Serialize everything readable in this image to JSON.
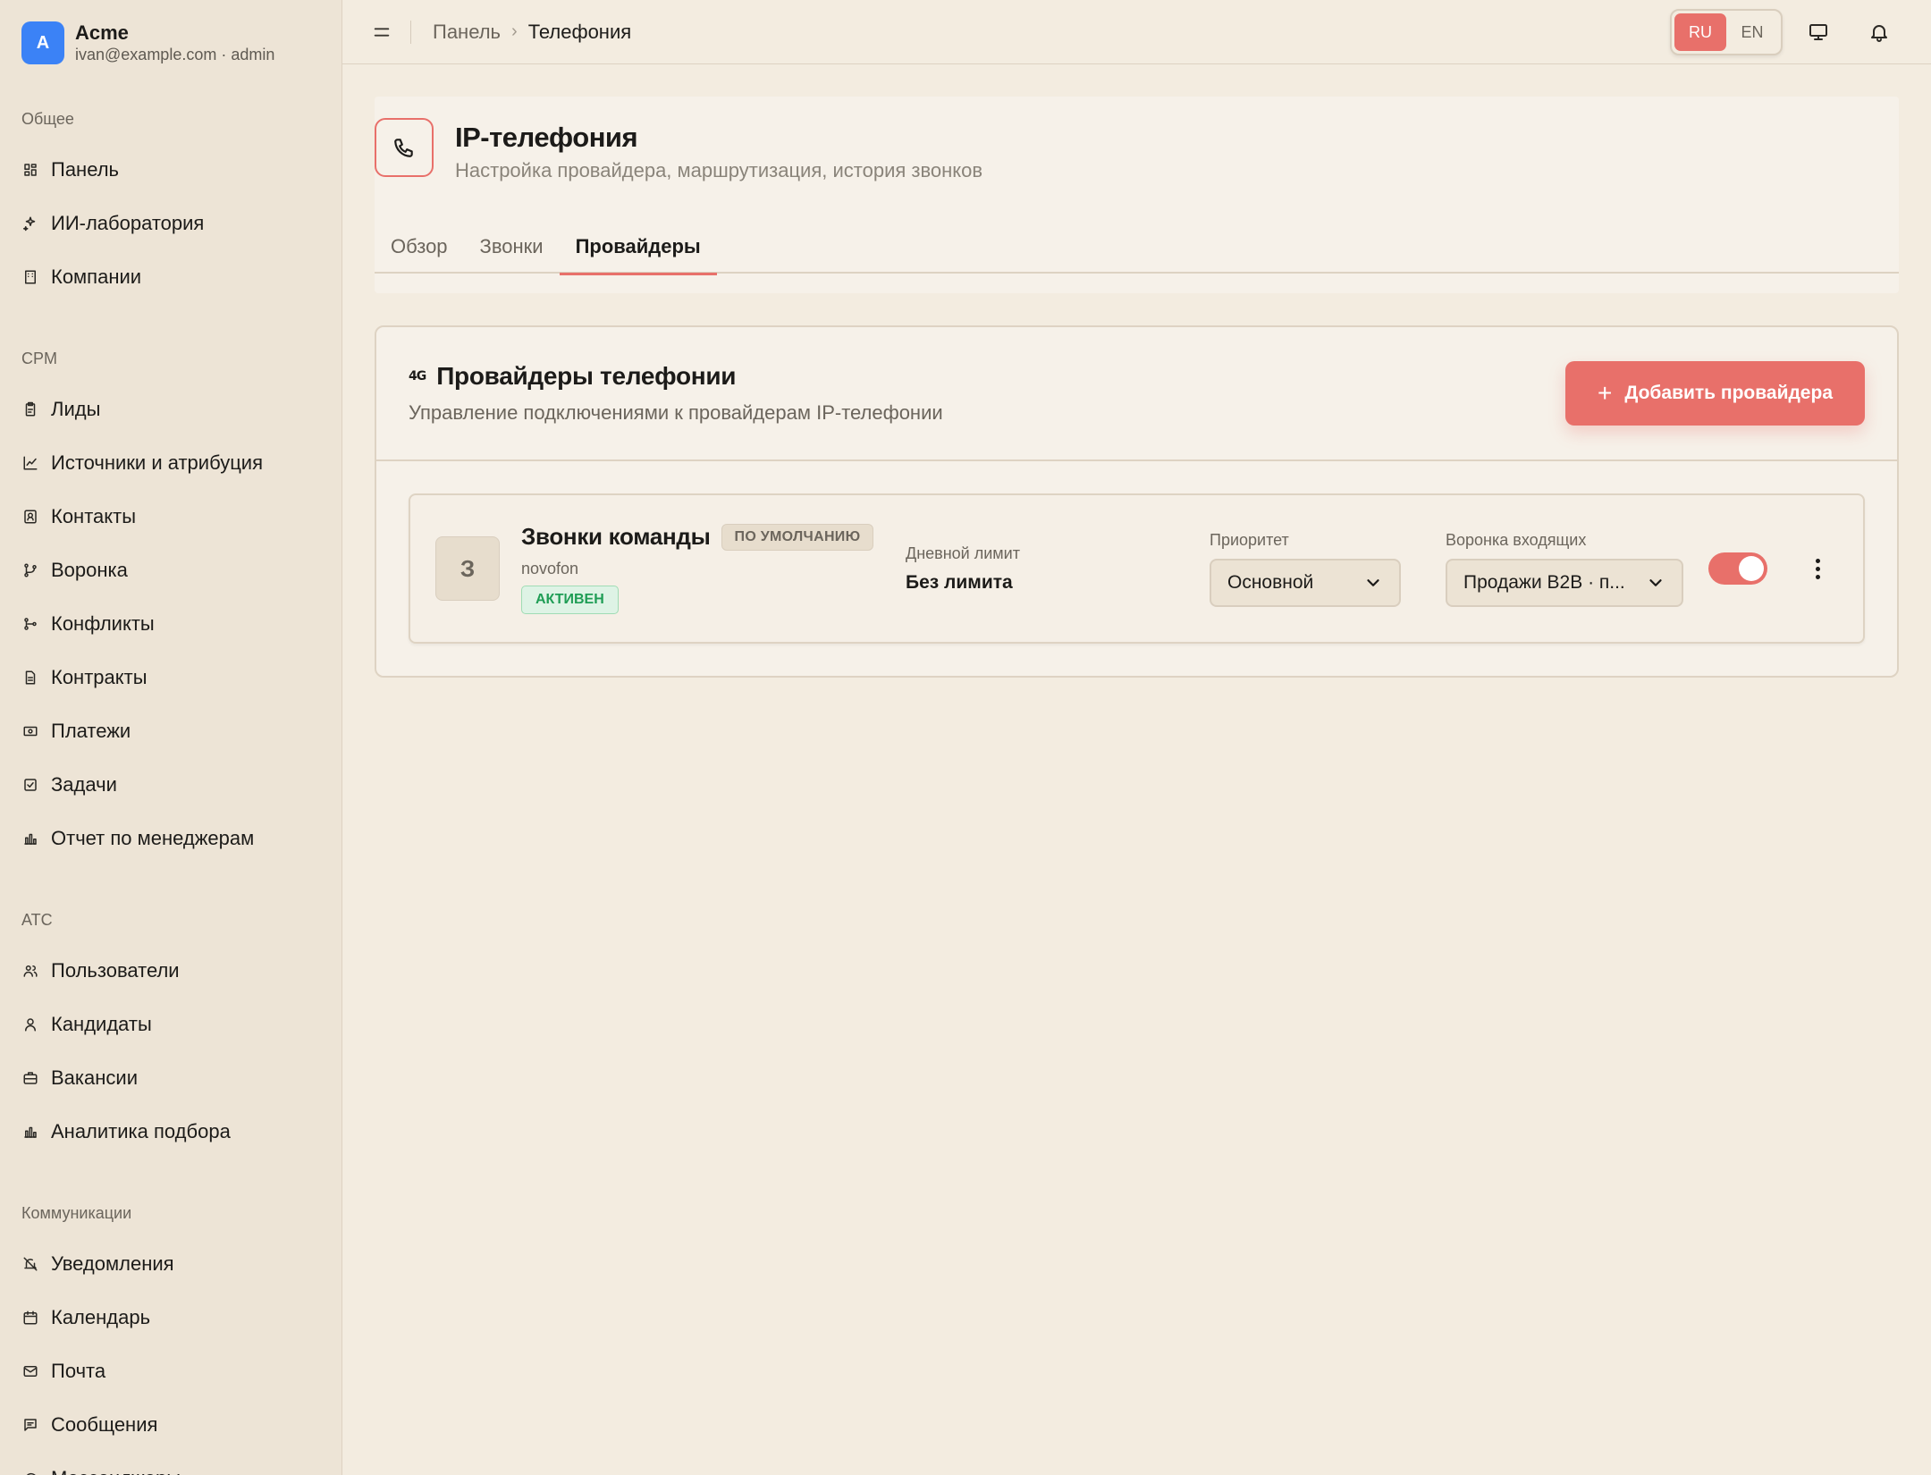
{
  "brand": {
    "initial": "A",
    "name": "Acme",
    "sub": "ivan@example.com · admin"
  },
  "sidebar": {
    "sections": [
      {
        "label": "Общее",
        "items": [
          {
            "label": "Панель",
            "icon": "dashboard-icon"
          },
          {
            "label": "ИИ-лаборатория",
            "icon": "sparkles-icon"
          },
          {
            "label": "Компании",
            "icon": "building-icon"
          }
        ]
      },
      {
        "label": "CPM",
        "items": [
          {
            "label": "Лиды",
            "icon": "clipboard-icon"
          },
          {
            "label": "Источники и атрибуция",
            "icon": "chart-line-icon"
          },
          {
            "label": "Контакты",
            "icon": "contact-icon"
          },
          {
            "label": "Воронка",
            "icon": "funnel-icon"
          },
          {
            "label": "Конфликты",
            "icon": "git-branch-icon"
          },
          {
            "label": "Контракты",
            "icon": "file-icon"
          },
          {
            "label": "Платежи",
            "icon": "banknote-icon"
          },
          {
            "label": "Задачи",
            "icon": "check-square-icon"
          },
          {
            "label": "Отчет по менеджерам",
            "icon": "bar-chart-icon"
          }
        ]
      },
      {
        "label": "ATC",
        "items": [
          {
            "label": "Пользователи",
            "icon": "users-icon"
          },
          {
            "label": "Кандидаты",
            "icon": "user-icon"
          },
          {
            "label": "Вакансии",
            "icon": "briefcase-icon"
          },
          {
            "label": "Аналитика подбора",
            "icon": "bar-chart-icon"
          }
        ]
      },
      {
        "label": "Коммуникации",
        "items": [
          {
            "label": "Уведомления",
            "icon": "bell-off-icon"
          },
          {
            "label": "Календарь",
            "icon": "calendar-icon"
          },
          {
            "label": "Почта",
            "icon": "mail-icon"
          },
          {
            "label": "Сообщения",
            "icon": "message-square-icon"
          },
          {
            "label": "Мессенджеры",
            "icon": "message-circle-icon"
          }
        ]
      }
    ]
  },
  "topbar": {
    "breadcrumb": [
      "Панель",
      "Телефония"
    ],
    "lang": [
      "RU",
      "EN"
    ],
    "lang_active": "RU"
  },
  "header": {
    "title": "IP-телефония",
    "subtitle": "Настройка провайдера, маршрутизация, история звонков",
    "tabs": [
      "Обзор",
      "Звонки",
      "Провайдеры"
    ],
    "active_tab": "Провайдеры"
  },
  "providers_card": {
    "signal_glyph": "4G",
    "title": "Провайдеры телефонии",
    "subtitle": "Управление подключениями к провайдерам IP-телефонии",
    "add_label": "Добавить провайдера",
    "provider": {
      "initial": "З",
      "name": "Звонки команды",
      "default_badge": "ПО УМОЛЧАНИЮ",
      "code": "novofon",
      "status": "АКТИВЕН",
      "limit_label": "Дневной лимит",
      "limit_value": "Без лимита",
      "priority_label": "Приоритет",
      "priority_value": "Основной",
      "funnel_label": "Воронка входящих",
      "funnel_value": "Продажи B2B · п...",
      "enabled": true
    }
  },
  "colors": {
    "accent": "#e8706a",
    "background": "#f3ece0",
    "sidebar": "#ede4d6",
    "success": "#1f9d55"
  }
}
